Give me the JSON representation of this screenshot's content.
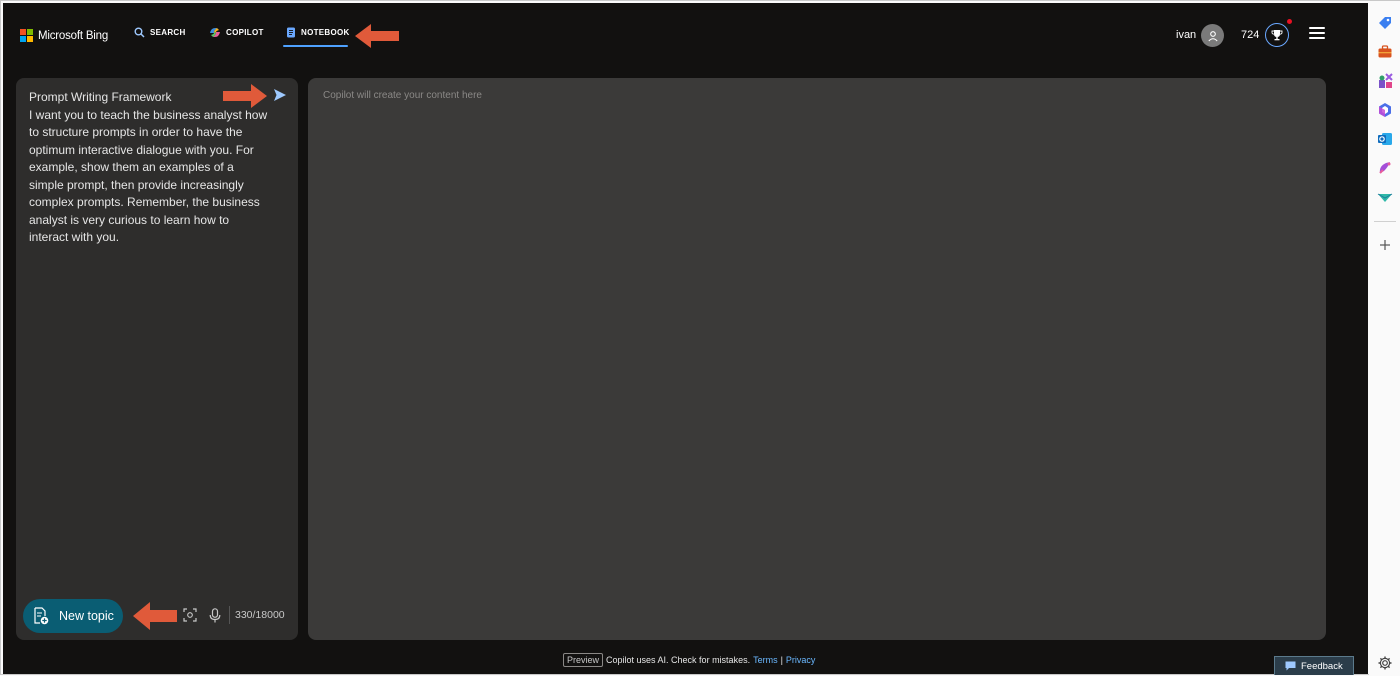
{
  "header": {
    "brand": "Microsoft Bing",
    "nav": [
      {
        "label": "SEARCH",
        "icon": "search-icon"
      },
      {
        "label": "COPILOT",
        "icon": "copilot-icon"
      },
      {
        "label": "NOTEBOOK",
        "icon": "notebook-icon",
        "active": true
      }
    ],
    "user_name": "ivan",
    "points": "724"
  },
  "notebook": {
    "prompt_text": "Prompt Writing Framework\nI want you to teach the business analyst how to structure prompts in order to have the optimum interactive dialogue with you. For example, show them an examples of a simple prompt, then provide increasingly complex prompts. Remember, the business analyst is very curious to learn how to interact with you.",
    "new_topic_label": "New topic",
    "char_counter": "330/18000",
    "output_placeholder": "Copilot will create your content here"
  },
  "footer": {
    "preview_label": "Preview",
    "disclaimer": "Copilot uses AI. Check for mistakes.",
    "terms_label": "Terms",
    "separator": "|",
    "privacy_label": "Privacy",
    "feedback_label": "Feedback"
  },
  "colors": {
    "app_background": "#121110",
    "panel_left": "#2e2d2c",
    "panel_right": "#3b3a39",
    "accent_blue": "#4ea1ff",
    "new_topic_bg": "#0a5d73",
    "annotation_arrow": "#e05a3a"
  },
  "edge_sidebar": {
    "icons": [
      "tag-icon",
      "briefcase-icon",
      "games-icon",
      "m365-icon",
      "outlook-icon",
      "designer-icon",
      "send-drop-icon",
      "add-icon",
      "settings-icon"
    ]
  }
}
